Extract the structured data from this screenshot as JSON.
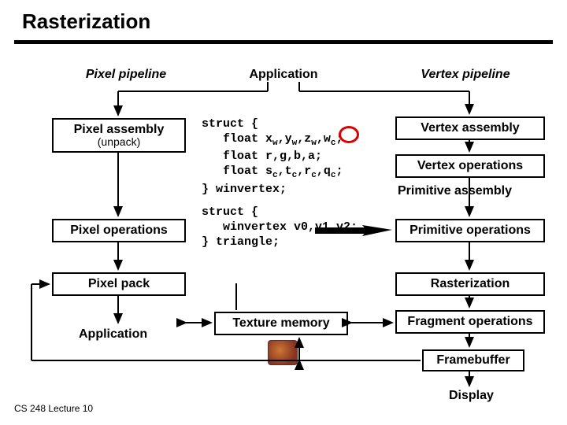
{
  "title": "Rasterization",
  "columns": {
    "left_head": "Pixel pipeline",
    "mid_head": "Application",
    "right_head": "Vertex pipeline"
  },
  "left": {
    "pixel_assembly": "Pixel assembly",
    "pixel_assembly_sub": "(unpack)",
    "pixel_operations": "Pixel operations",
    "pixel_pack": "Pixel pack",
    "application_out": "Application"
  },
  "mid": {
    "texture_memory": "Texture memory",
    "struct1_intro": "struct {",
    "struct1_close": "} winvertex;",
    "struct1_line2_a": "   float x",
    "struct1_line2_b": ",y",
    "struct1_line2_c": ",z",
    "struct1_line2_d": ",w",
    "struct1_line2_e": ";",
    "struct1_line3": "   float r,g,b,a;",
    "struct1_line4_a": "   float s",
    "struct1_line4_b": ",t",
    "struct1_line4_c": ",r",
    "struct1_line4_d": ",q",
    "struct1_line4_e": ";",
    "struct2_intro": "struct {",
    "struct2_line2": "   winvertex v0,v1,v2;",
    "struct2_close": "} triangle;",
    "sub_w": "w",
    "sub_c": "c"
  },
  "right": {
    "vertex_assembly": "Vertex assembly",
    "vertex_operations": "Vertex operations",
    "primitive_assembly": "Primitive assembly",
    "primitive_operations": "Primitive operations",
    "rasterization": "Rasterization",
    "fragment_operations": "Fragment operations",
    "framebuffer": "Framebuffer",
    "display": "Display"
  },
  "footer": "CS 248 Lecture 10",
  "chart_data": {
    "type": "diagram",
    "title": "Rasterization",
    "nodes": [
      {
        "id": "app_top",
        "label": "Application",
        "kind": "header"
      },
      {
        "id": "pixel_assembly",
        "label": "Pixel assembly (unpack)",
        "column": "pixel"
      },
      {
        "id": "pixel_operations",
        "label": "Pixel operations",
        "column": "pixel"
      },
      {
        "id": "pixel_pack",
        "label": "Pixel pack",
        "column": "pixel"
      },
      {
        "id": "app_bottom",
        "label": "Application",
        "column": "pixel",
        "kind": "terminal"
      },
      {
        "id": "vertex_assembly",
        "label": "Vertex assembly",
        "column": "vertex"
      },
      {
        "id": "vertex_operations",
        "label": "Vertex operations",
        "column": "vertex"
      },
      {
        "id": "primitive_assembly",
        "label": "Primitive assembly",
        "column": "vertex"
      },
      {
        "id": "primitive_operations",
        "label": "Primitive operations",
        "column": "vertex"
      },
      {
        "id": "rasterization",
        "label": "Rasterization",
        "column": "vertex"
      },
      {
        "id": "fragment_operations",
        "label": "Fragment operations",
        "column": "vertex"
      },
      {
        "id": "framebuffer",
        "label": "Framebuffer",
        "column": "vertex"
      },
      {
        "id": "display",
        "label": "Display",
        "column": "vertex",
        "kind": "terminal"
      },
      {
        "id": "texture_memory",
        "label": "Texture memory",
        "column": "mid"
      },
      {
        "id": "winvertex_struct",
        "label": "struct { float xw,yw,zw,wc; float r,g,b,a; float sc,tc,rc,qc; } winvertex;",
        "kind": "code"
      },
      {
        "id": "triangle_struct",
        "label": "struct { winvertex v0,v1,v2; } triangle;",
        "kind": "code"
      }
    ],
    "edges": [
      {
        "from": "app_top",
        "to": "pixel_assembly"
      },
      {
        "from": "app_top",
        "to": "vertex_assembly"
      },
      {
        "from": "pixel_assembly",
        "to": "pixel_operations"
      },
      {
        "from": "pixel_operations",
        "to": "pixel_pack"
      },
      {
        "from": "pixel_pack",
        "to": "app_bottom"
      },
      {
        "from": "vertex_assembly",
        "to": "vertex_operations"
      },
      {
        "from": "vertex_operations",
        "to": "primitive_assembly"
      },
      {
        "from": "primitive_assembly",
        "to": "primitive_operations"
      },
      {
        "from": "primitive_operations",
        "to": "rasterization"
      },
      {
        "from": "rasterization",
        "to": "fragment_operations"
      },
      {
        "from": "fragment_operations",
        "to": "framebuffer"
      },
      {
        "from": "framebuffer",
        "to": "display"
      },
      {
        "from": "pixel_operations",
        "to": "texture_memory",
        "bidir": true
      },
      {
        "from": "texture_memory",
        "to": "fragment_operations",
        "bidir": true
      },
      {
        "from": "texture_memory",
        "to": "framebuffer",
        "bidir": true,
        "via": "left-loop"
      },
      {
        "from": "framebuffer",
        "to": "pixel_pack",
        "via": "left-loop"
      },
      {
        "from": "primitive_operations",
        "to": "winvertex_struct",
        "annotation": "output-type"
      },
      {
        "from": "triangle_struct",
        "to": "primitive_operations",
        "annotation": "input-type"
      }
    ],
    "highlight": {
      "node": "winvertex_struct",
      "token": "wc",
      "style": "red-circle"
    }
  }
}
